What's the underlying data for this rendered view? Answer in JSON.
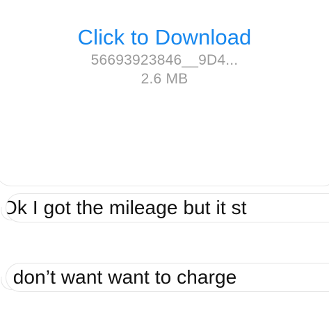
{
  "attachment": {
    "download_label": "Click to Download",
    "file_name": "56693923846__9D4...",
    "file_size": "2.6 MB"
  },
  "messages": [
    {
      "text": "Ok I got the mileage but it st"
    },
    {
      "text": "I don’t want want to charge"
    }
  ],
  "colors": {
    "link": "#1687ee",
    "secondary_text": "#9a9a9a",
    "message_text": "#111111",
    "bubble_border": "#e5e5e5"
  }
}
